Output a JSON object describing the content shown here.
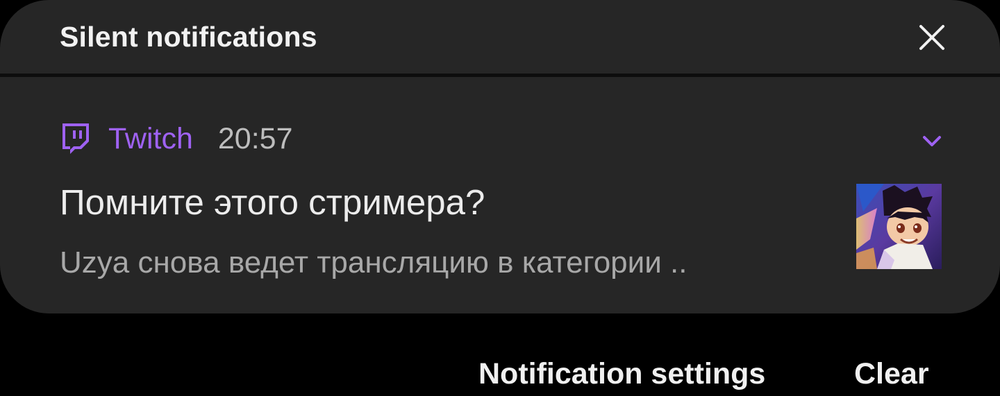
{
  "header": {
    "title": "Silent notifications",
    "close_icon": "close-icon"
  },
  "notification": {
    "app": {
      "icon": "twitch-icon",
      "name": "Twitch",
      "time": "20:57",
      "accent_color": "#9f62f3"
    },
    "expand_icon": "chevron-down-icon",
    "title": "Помните этого стримера?",
    "body": "Uzya снова ведет трансляцию в категории ..",
    "thumbnail": "stream-thumbnail-image"
  },
  "footer": {
    "settings_label": "Notification settings",
    "clear_label": "Clear"
  },
  "colors": {
    "background": "#000000",
    "panel": "#262626",
    "accent": "#9f62f3"
  }
}
